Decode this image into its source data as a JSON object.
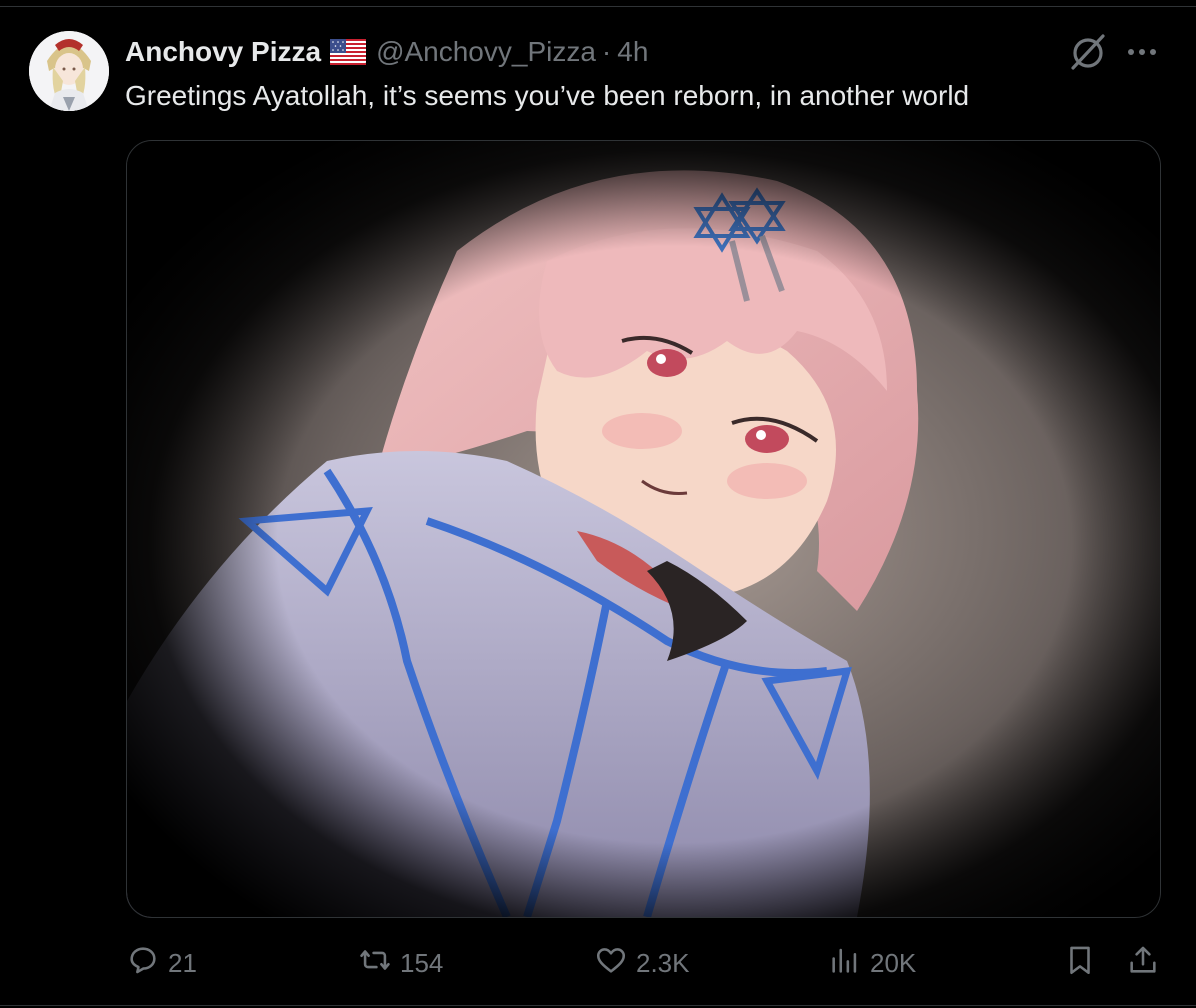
{
  "tweet": {
    "display_name": "Anchovy Pizza",
    "flag_icon": "us-flag-icon",
    "handle": "@Anchovy_Pizza",
    "separator": "·",
    "time": "4h",
    "text": "Greetings Ayatollah, it’s seems you’ve been reborn, in another world"
  },
  "actions": {
    "replies": "21",
    "reposts": "154",
    "likes": "2.3K",
    "views": "20K"
  },
  "icons": {
    "reply": "reply-icon",
    "repost": "repost-icon",
    "like": "heart-icon",
    "views": "views-icon",
    "bookmark": "bookmark-icon",
    "share": "share-icon",
    "grok": "grok-icon",
    "more": "more-icon"
  },
  "colors": {
    "background": "#000000",
    "text": "#e7e9ea",
    "muted": "#71767b",
    "border": "#2f3336"
  }
}
